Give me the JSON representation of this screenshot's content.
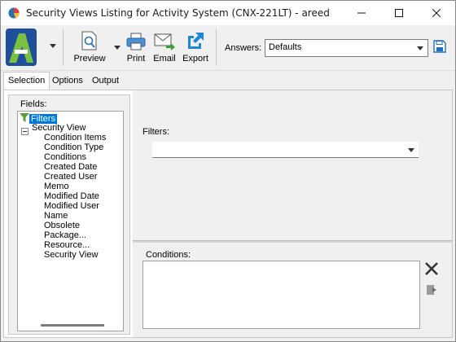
{
  "window": {
    "title": "Security Views Listing for Activity System (CNX-221LT) - areed"
  },
  "toolbar": {
    "preview_label": "Preview",
    "print_label": "Print",
    "email_label": "Email",
    "export_label": "Export",
    "answers_label": "Answers:",
    "answers_value": "Defaults"
  },
  "tabs": [
    {
      "label": "Selection",
      "active": true
    },
    {
      "label": "Options",
      "active": false
    },
    {
      "label": "Output",
      "active": false
    }
  ],
  "fields": {
    "label": "Fields:",
    "tree": {
      "filters": "Filters",
      "root": "Security View",
      "children": [
        "Condition Items",
        "Condition Type",
        "Conditions",
        "Created Date",
        "Created User",
        "Memo",
        "Modified Date",
        "Modified User",
        "Name",
        "Obsolete",
        "Package...",
        "Resource...",
        "Security View"
      ]
    }
  },
  "filters": {
    "label": "Filters:",
    "value": ""
  },
  "conditions": {
    "label": "Conditions:"
  },
  "colors": {
    "accent": "#0078d7",
    "logo_green": "#7ac142",
    "logo_blue": "#1f4e9b",
    "filter_icon": "#5aa02c",
    "export_icon": "#1e88d6"
  }
}
